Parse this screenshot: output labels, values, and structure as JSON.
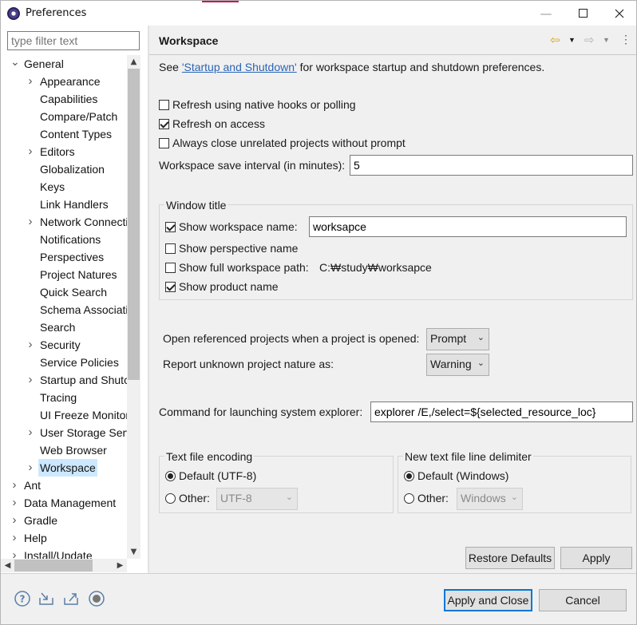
{
  "window": {
    "title": "Preferences"
  },
  "filter": {
    "placeholder": "type filter text"
  },
  "tree": [
    {
      "label": "General",
      "level": 0,
      "expandable": true,
      "expanded": true
    },
    {
      "label": "Appearance",
      "level": 1,
      "expandable": true
    },
    {
      "label": "Capabilities",
      "level": 1,
      "expandable": false
    },
    {
      "label": "Compare/Patch",
      "level": 1,
      "expandable": false
    },
    {
      "label": "Content Types",
      "level": 1,
      "expandable": false
    },
    {
      "label": "Editors",
      "level": 1,
      "expandable": true
    },
    {
      "label": "Globalization",
      "level": 1,
      "expandable": false
    },
    {
      "label": "Keys",
      "level": 1,
      "expandable": false
    },
    {
      "label": "Link Handlers",
      "level": 1,
      "expandable": false
    },
    {
      "label": "Network Connecti",
      "level": 1,
      "expandable": true
    },
    {
      "label": "Notifications",
      "level": 1,
      "expandable": false
    },
    {
      "label": "Perspectives",
      "level": 1,
      "expandable": false
    },
    {
      "label": "Project Natures",
      "level": 1,
      "expandable": false
    },
    {
      "label": "Quick Search",
      "level": 1,
      "expandable": false
    },
    {
      "label": "Schema Associatic",
      "level": 1,
      "expandable": false
    },
    {
      "label": "Search",
      "level": 1,
      "expandable": false
    },
    {
      "label": "Security",
      "level": 1,
      "expandable": true
    },
    {
      "label": "Service Policies",
      "level": 1,
      "expandable": false
    },
    {
      "label": "Startup and Shutc",
      "level": 1,
      "expandable": true
    },
    {
      "label": "Tracing",
      "level": 1,
      "expandable": false
    },
    {
      "label": "UI Freeze Monitor",
      "level": 1,
      "expandable": false
    },
    {
      "label": "User Storage Serv",
      "level": 1,
      "expandable": true
    },
    {
      "label": "Web Browser",
      "level": 1,
      "expandable": false
    },
    {
      "label": "Workspace",
      "level": 1,
      "expandable": true,
      "selected": true
    },
    {
      "label": "Ant",
      "level": 0,
      "expandable": true
    },
    {
      "label": "Data Management",
      "level": 0,
      "expandable": true
    },
    {
      "label": "Gradle",
      "level": 0,
      "expandable": true
    },
    {
      "label": "Help",
      "level": 0,
      "expandable": true
    },
    {
      "label": "Install/Update",
      "level": 0,
      "expandable": true
    }
  ],
  "page": {
    "title": "Workspace",
    "see_prefix": "See ",
    "see_link": "'Startup and Shutdown'",
    "see_suffix": " for workspace startup and shutdown preferences.",
    "refresh_native": {
      "label": "Refresh using native hooks or polling",
      "checked": false
    },
    "refresh_access": {
      "label": "Refresh on access",
      "checked": true
    },
    "always_close": {
      "label": "Always close unrelated projects without prompt",
      "checked": false
    },
    "save_interval_label": "Workspace save interval (in minutes):",
    "save_interval_value": "5",
    "window_title": {
      "group_label": "Window title",
      "show_workspace_name": {
        "label": "Show workspace name:",
        "checked": true,
        "value": "worksapce"
      },
      "show_perspective_name": {
        "label": "Show perspective name",
        "checked": false
      },
      "show_full_path": {
        "label": "Show full workspace path:",
        "checked": false,
        "value": "C:₩study₩worksapce"
      },
      "show_product_name": {
        "label": "Show product name",
        "checked": true
      }
    },
    "open_referenced_label": "Open referenced projects when a project is opened:",
    "open_referenced_value": "Prompt",
    "report_unknown_label": "Report unknown project nature as:",
    "report_unknown_value": "Warning",
    "command_label": "Command for launching system explorer:",
    "command_value": "explorer /E,/select=${selected_resource_loc}",
    "encoding": {
      "group_label": "Text file encoding",
      "default_label": "Default (UTF-8)",
      "other_label": "Other:",
      "other_value": "UTF-8",
      "selected": "default"
    },
    "delimiter": {
      "group_label": "New text file line delimiter",
      "default_label": "Default (Windows)",
      "other_label": "Other:",
      "other_value": "Windows",
      "selected": "default"
    },
    "restore_defaults": "Restore Defaults",
    "apply": "Apply"
  },
  "footer": {
    "apply_and_close": "Apply and Close",
    "cancel": "Cancel"
  },
  "icons": {
    "help": "help-icon",
    "import": "import-icon",
    "export": "export-icon",
    "record": "record-icon"
  }
}
